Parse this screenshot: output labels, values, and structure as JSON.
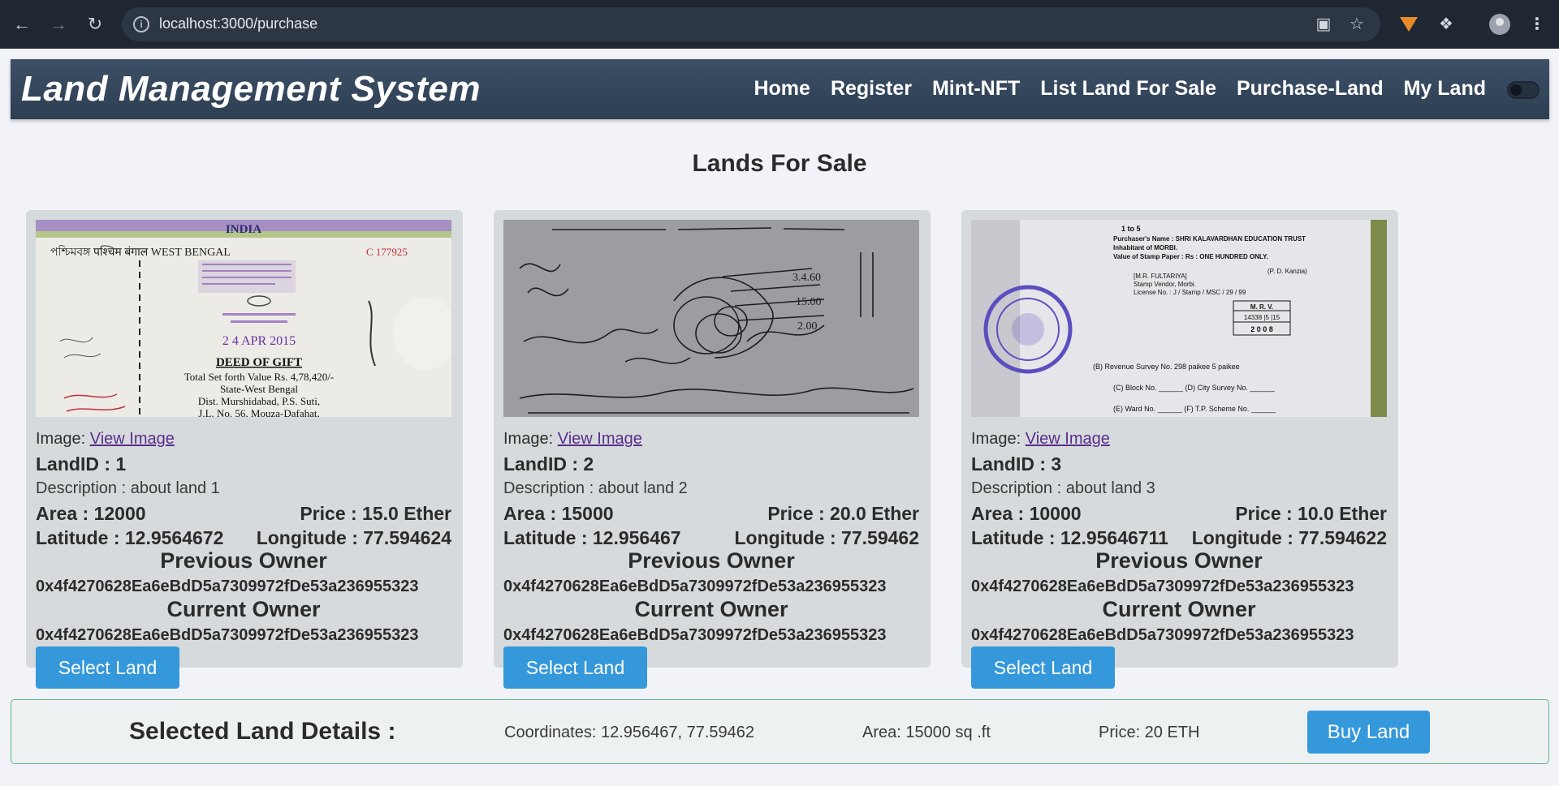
{
  "browser": {
    "url": "localhost:3000/purchase",
    "icons": [
      "back-icon",
      "forward-icon",
      "reload-icon",
      "site-info-icon",
      "install-app-icon",
      "bookmark-star-icon",
      "metamask-fox-icon",
      "extensions-puzzle-icon",
      "profile-avatar-icon",
      "more-menu-icon"
    ]
  },
  "navbar": {
    "brand": "Land Management System",
    "links": [
      "Home",
      "Register",
      "Mint-NFT",
      "List Land For Sale",
      "Purchase-Land",
      "My Land"
    ]
  },
  "page_title": "Lands For Sale",
  "cards": [
    {
      "image_label": "Image:",
      "image_link": "View Image",
      "land_id": "LandID : 1",
      "description": "Description : about land 1",
      "area": "Area : 12000",
      "price": "Price : 15.0 Ether",
      "latitude": "Latitude : 12.9564672",
      "longitude": "Longitude : 77.594624",
      "previous_owner_label": "Previous Owner",
      "previous_owner": "0x4f4270628Ea6eBdD5a7309972fDe53a236955323",
      "current_owner_label": "Current Owner",
      "current_owner": "0x4f4270628Ea6eBdD5a7309972fDe53a236955323",
      "button": "Select Land",
      "photo": {
        "header_band": "INDIA",
        "line1": "পশ্চিমবঙ্গ पश्चिम बंगाल WEST BENGAL",
        "serial": "C 177925",
        "stamp_date": "2 4 APR 2015",
        "title": "DEED OF GIFT",
        "line2": "Total Set forth Value Rs. 4,78,420/-",
        "line3": "State-West Bengal",
        "line4": "Dist. Murshidabad, P.S. Suti,",
        "line5": "J.L. No. 56, Mouza-Dafahat,"
      }
    },
    {
      "image_label": "Image:",
      "image_link": "View Image",
      "land_id": "LandID : 2",
      "description": "Description : about land 2",
      "area": "Area : 15000",
      "price": "Price : 20.0 Ether",
      "latitude": "Latitude : 12.956467",
      "longitude": "Longitude : 77.59462",
      "previous_owner_label": "Previous Owner",
      "previous_owner": "0x4f4270628Ea6eBdD5a7309972fDe53a236955323",
      "current_owner_label": "Current Owner",
      "current_owner": "0x4f4270628Ea6eBdD5a7309972fDe53a236955323",
      "button": "Select Land"
    },
    {
      "image_label": "Image:",
      "image_link": "View Image",
      "land_id": "LandID : 3",
      "description": "Description : about land 3",
      "area": "Area : 10000",
      "price": "Price : 10.0 Ether",
      "latitude": "Latitude : 12.95646711",
      "longitude": "Longitude : 77.594622",
      "previous_owner_label": "Previous Owner",
      "previous_owner": "0x4f4270628Ea6eBdD5a7309972fDe53a236955323",
      "current_owner_label": "Current Owner",
      "current_owner": "0x4f4270628Ea6eBdD5a7309972fDe53a236955323",
      "button": "Select Land",
      "photo": {
        "line1": "1 to 5",
        "line2": "Purchaser's Name : SHRI KALAVARDHAN EDUCATION TRUST",
        "line3": "Inhabitant of        MORBI.",
        "line4": "Value of Stamp Paper : Rs : ONE HUNDRED ONLY.",
        "line5": "[M.R. FULTARIYA]",
        "line6": "Stamp Vendor, Morbi.",
        "line7": "License No. : J / Stamp / MSC / 29 / 99",
        "line8": "(P. D. Kanzia)",
        "box1": "M.  R.  V.",
        "box2": "14338 |5 |15",
        "box3": "2 0 0 8",
        "line9": "(B)   Revenue Survey No. 298 paikee 5 paikee",
        "line10": "(C)  Block No.  ______   (D)  City Survey No. ______",
        "line11": "(E)  Ward No.  ______   (F)  T.P. Scheme No. ______"
      }
    }
  ],
  "selected": {
    "title": "Selected Land Details :",
    "coordinates": "Coordinates: 12.956467, 77.59462",
    "area": "Area: 15000 sq .ft",
    "price": "Price: 20 ETH",
    "button": "Buy Land"
  },
  "colors": {
    "navbar": "#34475c",
    "button": "#3498db",
    "card": "#d6dadc",
    "page_bg": "#f2f3f8"
  }
}
